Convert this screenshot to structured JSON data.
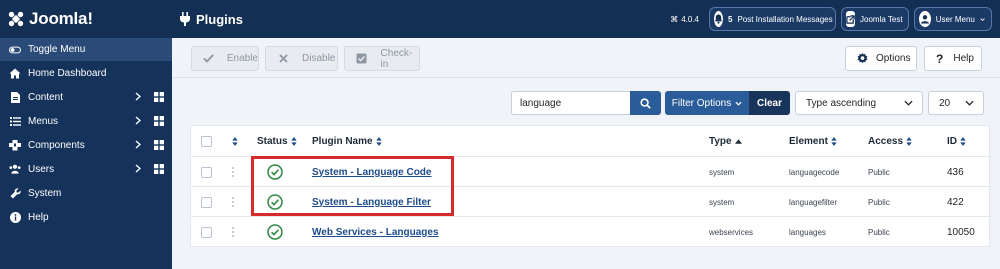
{
  "header": {
    "logo_text": "Joomla!",
    "page_title": "Plugins",
    "version": "4.0.4",
    "post_install": {
      "count": "5",
      "label": "Post Installation Messages"
    },
    "site_link": "Joomla Test",
    "user_menu": "User Menu"
  },
  "sidebar": {
    "items": [
      {
        "label": "Toggle Menu",
        "icon": "toggle-icon"
      },
      {
        "label": "Home Dashboard",
        "icon": "home-icon"
      },
      {
        "label": "Content",
        "icon": "file-icon",
        "has_submenu": true
      },
      {
        "label": "Menus",
        "icon": "list-icon",
        "has_submenu": true
      },
      {
        "label": "Components",
        "icon": "cube-icon",
        "has_submenu": true
      },
      {
        "label": "Users",
        "icon": "users-icon",
        "has_submenu": true
      },
      {
        "label": "System",
        "icon": "wrench-icon"
      },
      {
        "label": "Help",
        "icon": "info-icon"
      }
    ]
  },
  "toolbar": {
    "enable": "Enable",
    "disable": "Disable",
    "checkin": "Check-in",
    "options": "Options",
    "help": "Help"
  },
  "filters": {
    "search_value": "language",
    "filter_options": "Filter Options",
    "clear": "Clear",
    "sort": "Type ascending",
    "limit": "20"
  },
  "table": {
    "headers": {
      "status": "Status",
      "name": "Plugin Name",
      "type": "Type",
      "element": "Element",
      "access": "Access",
      "id": "ID"
    },
    "rows": [
      {
        "name": "System - Language Code",
        "type": "system",
        "element": "languagecode",
        "access": "Public",
        "id": "436",
        "status": "enabled"
      },
      {
        "name": "System - Language Filter",
        "type": "system",
        "element": "languagefilter",
        "access": "Public",
        "id": "422",
        "status": "enabled"
      },
      {
        "name": "Web Services - Languages",
        "type": "webservices",
        "element": "languages",
        "access": "Public",
        "id": "10050",
        "status": "enabled"
      }
    ]
  },
  "colors": {
    "header_bg": "#132f53",
    "sidebar_bg": "#14325a",
    "primary": "#2a5c9a",
    "status_ok": "#2f8a45",
    "highlight": "#d72a2a"
  }
}
